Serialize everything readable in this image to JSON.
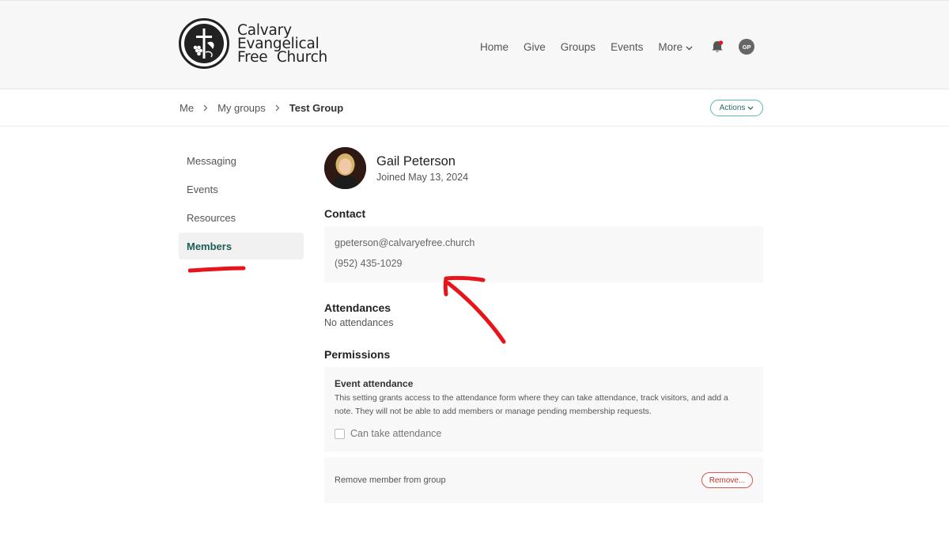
{
  "header": {
    "logo_lines": [
      "Calvary",
      "Evangelical",
      "Free  Church"
    ],
    "nav": [
      {
        "label": "Home"
      },
      {
        "label": "Give"
      },
      {
        "label": "Groups"
      },
      {
        "label": "Events"
      },
      {
        "label": "More"
      }
    ],
    "user_initials": "GP"
  },
  "breadcrumb": {
    "items": [
      "Me",
      "My groups",
      "Test Group"
    ],
    "actions_label": "Actions"
  },
  "sidebar": {
    "items": [
      {
        "label": "Messaging",
        "active": false
      },
      {
        "label": "Events",
        "active": false
      },
      {
        "label": "Resources",
        "active": false
      },
      {
        "label": "Members",
        "active": true
      }
    ]
  },
  "member": {
    "name": "Gail Peterson",
    "joined": "Joined May 13, 2024"
  },
  "contact": {
    "title": "Contact",
    "email": "gpeterson@calvaryefree.church",
    "phone": "(952) 435-1029"
  },
  "attendances": {
    "title": "Attendances",
    "empty_text": "No attendances"
  },
  "permissions": {
    "title": "Permissions",
    "event_attendance_title": "Event attendance",
    "event_attendance_desc": "This setting grants access to the attendance form where they can take attendance, track visitors, and add a note. They will not be able to add members or manage pending membership requests.",
    "checkbox_label": "Can take attendance",
    "checkbox_checked": false
  },
  "remove": {
    "label": "Remove member from group",
    "button_label": "Remove..."
  },
  "colors": {
    "accent": "#1f5e57",
    "actions_border": "#5bb8ad",
    "danger": "#d9534f",
    "annotation": "#e8141b"
  },
  "icons": {
    "nav_more": "chevron-down-icon",
    "notifications": "bell-icon",
    "breadcrumb_sep": "chevron-right-icon",
    "actions": "chevron-down-icon"
  }
}
